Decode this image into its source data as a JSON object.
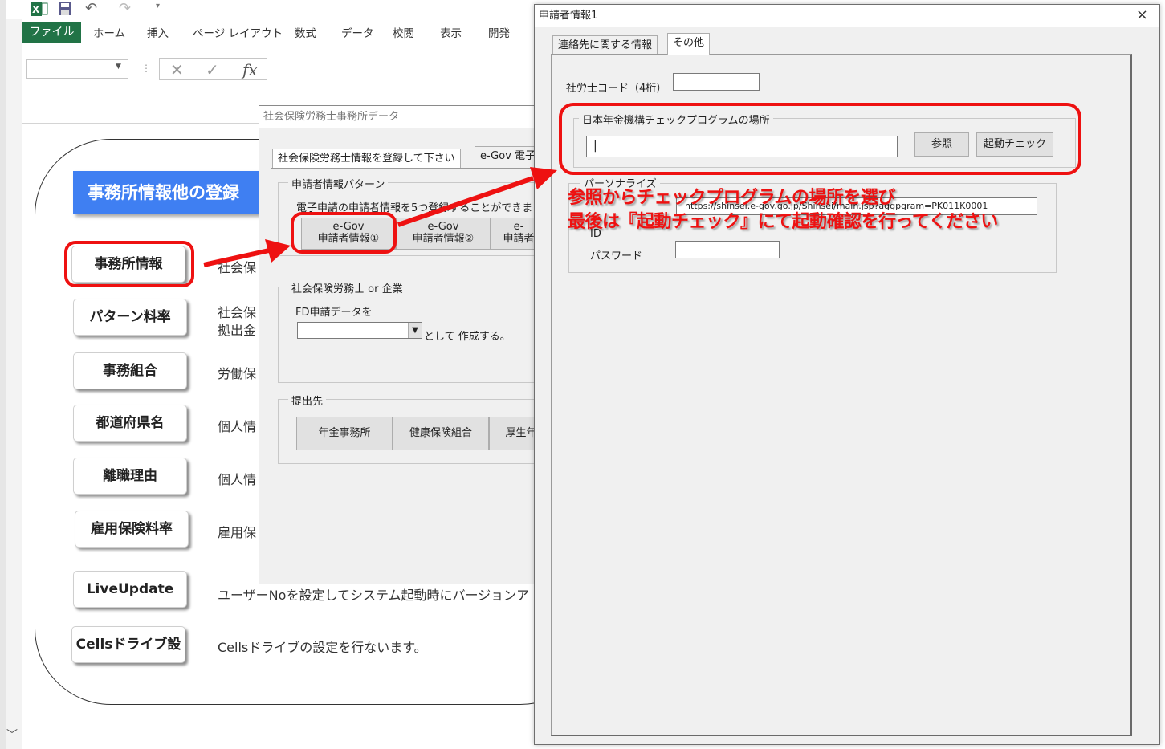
{
  "excel": {
    "tabs": [
      "ファイル",
      "ホーム",
      "挿入",
      "ページ レイアウト",
      "数式",
      "データ",
      "校閲",
      "表示",
      "開発"
    ],
    "fx_label": "fx"
  },
  "sheet": {
    "title": "事務所情報他の登録",
    "buttons": [
      {
        "label": "事務所情報",
        "desc": "社会保"
      },
      {
        "label": "パターン料率",
        "desc": "社会保"
      },
      {
        "label": "事務組合",
        "desc": "労働保"
      },
      {
        "label": "都道府県名",
        "desc": "個人情"
      },
      {
        "label": "離職理由",
        "desc": "個人情"
      },
      {
        "label": "雇用保険料率",
        "desc": "雇用保"
      },
      {
        "label": "LiveUpdate",
        "desc": "ユーザーNoを設定してシステム起動時にバージョンア"
      },
      {
        "label": "Cellsドライブ設",
        "desc": "Cellsドライブの設定を行ないます。"
      }
    ],
    "desc2_line2": "拠出金"
  },
  "dialog_office": {
    "title": "社会保険労務士事務所データ",
    "tabs": [
      "社会保険労務士情報を登録して下さい",
      "e-Gov 電子"
    ],
    "group1_label": "申請者情報パターン",
    "group1_desc": "電子申請の申請者情報を5つ登録することができま",
    "pattern_buttons": [
      {
        "line1": "e-Gov",
        "line2": "申請者情報①"
      },
      {
        "line1": "e-Gov",
        "line2": "申請者情報②"
      },
      {
        "line1": "e-",
        "line2": "申請者"
      }
    ],
    "group2_label": "社会保険労務士 or 企業",
    "fd_label": "FD申請データを",
    "fd_suffix": "として 作成する。",
    "group3_label": "提出先",
    "submit_buttons": [
      "年金事務所",
      "健康保険組合",
      "厚生年"
    ]
  },
  "dialog_applicant": {
    "title": "申請者情報1",
    "close": "×",
    "tabs": [
      "連絡先に関する情報",
      "その他"
    ],
    "code_label": "社労士コード（4桁）",
    "code_value": "",
    "group_label": "日本年金機構チェックプログラムの場所",
    "path_value": "|",
    "browse_button": "参照",
    "launch_button": "起動チェック",
    "portal_group_label": "パーソナライズ",
    "portal_url": "https://shinsei.e-gov.go.jp/Shinsei/main.jsp?aggpgram=PK011K0001",
    "id_label": "ID",
    "password_label": "パスワード",
    "password_value": ""
  },
  "annotation": {
    "line1": "参照からチェックプログラムの場所を選び",
    "line2": "最後は『起動チェック』にて起動確認を行ってください",
    "color": "#ee1111"
  }
}
